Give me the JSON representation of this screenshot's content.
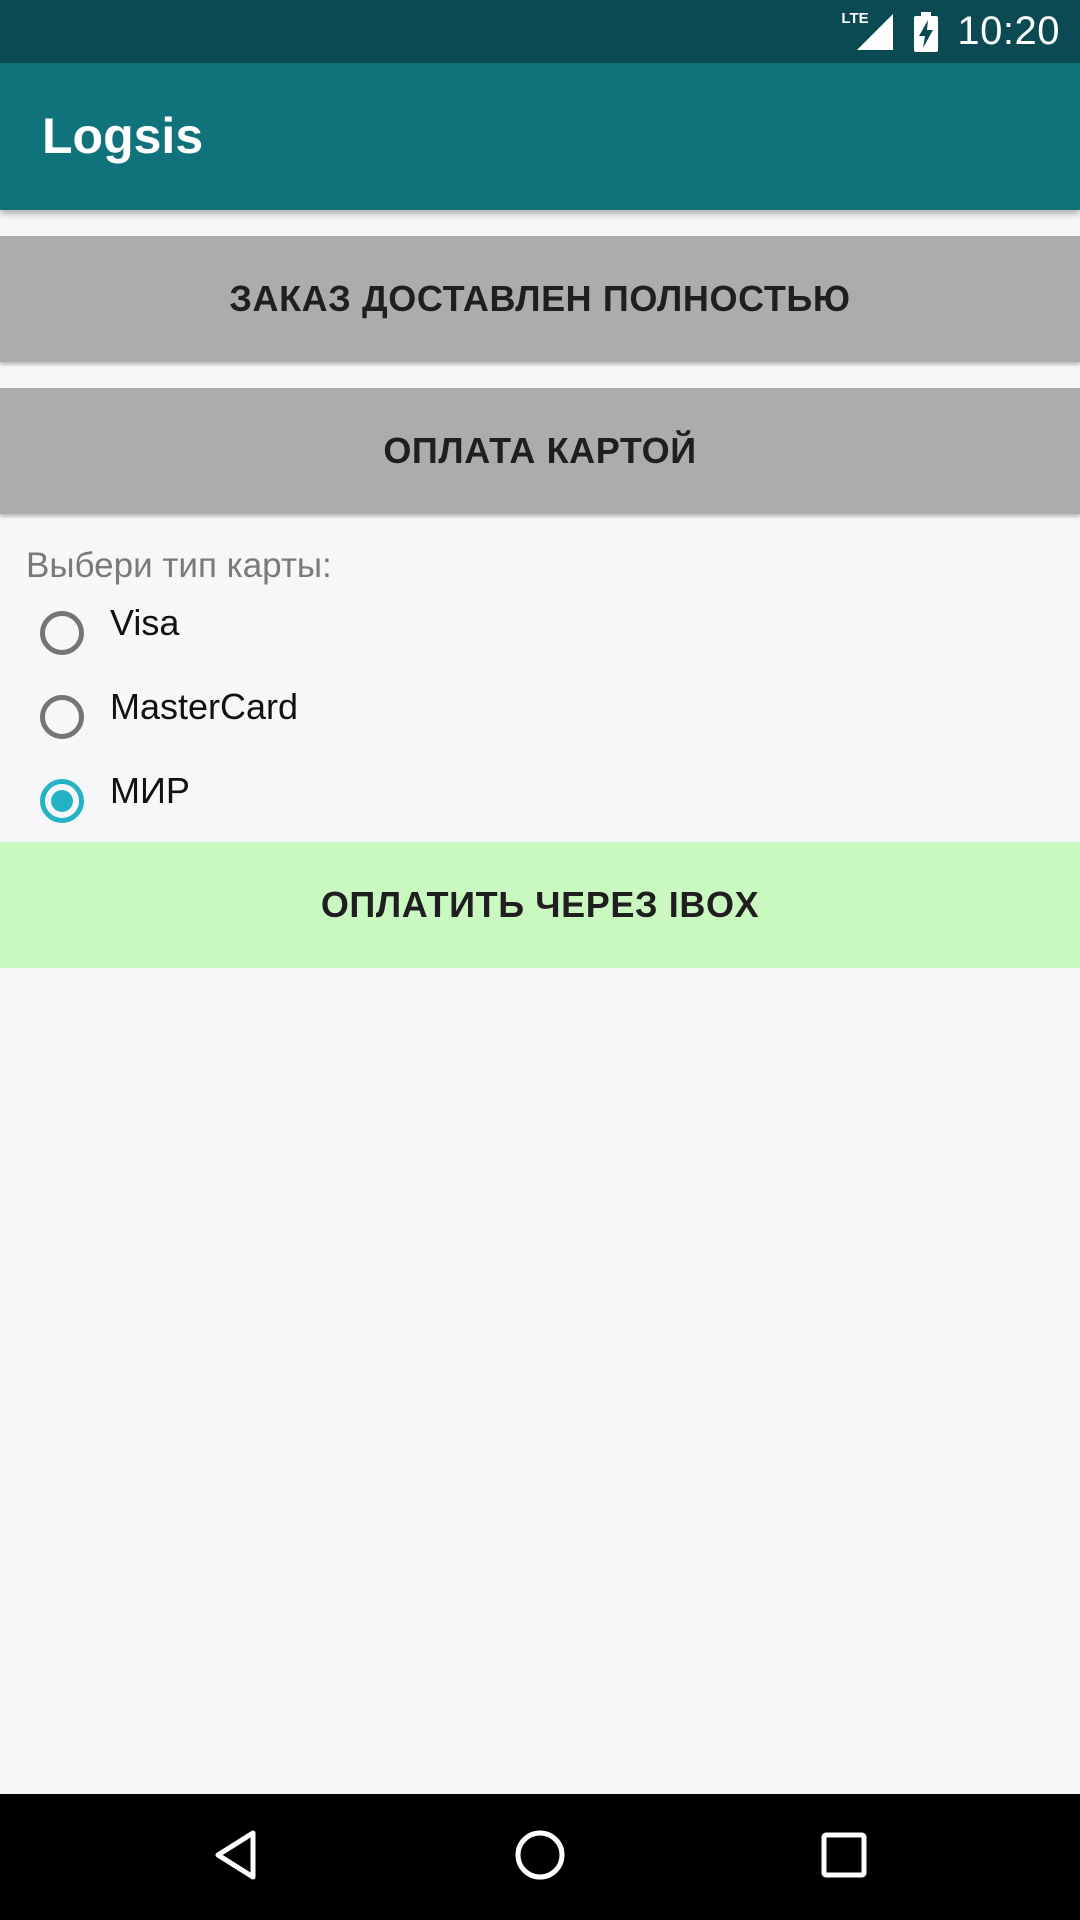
{
  "status_bar": {
    "network": "LTE",
    "time": "10:20",
    "icons": [
      "signal-icon",
      "battery-charging-icon"
    ]
  },
  "app_bar": {
    "title": "Logsis"
  },
  "actions": {
    "delivered_label": "ЗАКАЗ ДОСТАВЛЕН ПОЛНОСТЬЮ",
    "card_payment_label": "ОПЛАТА КАРТОЙ",
    "pay_ibox_label": "ОПЛАТИТЬ ЧЕРЕЗ IBOX"
  },
  "card_type": {
    "prompt": "Выбери тип карты:",
    "options": [
      {
        "label": "Visa",
        "selected": false
      },
      {
        "label": "MasterCard",
        "selected": false
      },
      {
        "label": "МИР",
        "selected": true
      }
    ]
  },
  "navigation": {
    "icons": [
      "back-icon",
      "home-icon",
      "recents-icon"
    ]
  },
  "colors": {
    "status_bar": "#0c4a53",
    "app_bar": "#10727a",
    "button_gray": "#acacae",
    "button_green": "#c9f8c1",
    "radio_accent": "#24b3c4"
  }
}
